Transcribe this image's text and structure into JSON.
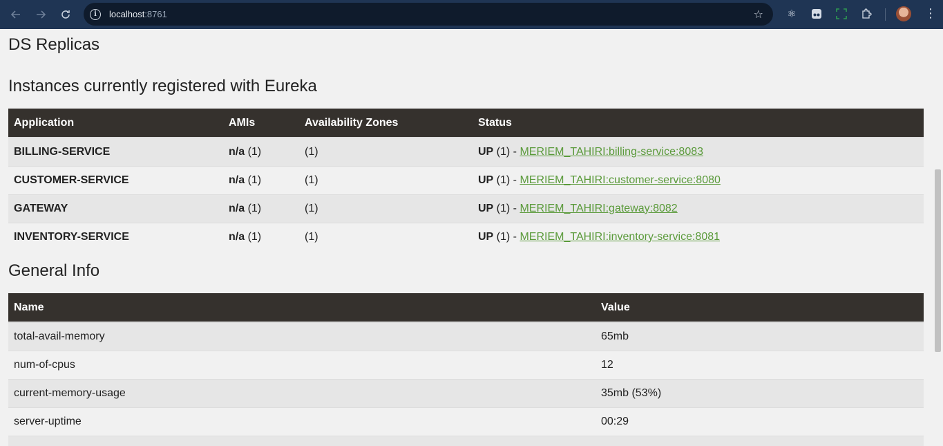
{
  "browser": {
    "url_host": "localhost",
    "url_port": ":8761"
  },
  "page": {
    "ds_replicas_title": "DS Replicas",
    "instances_title": "Instances currently registered with Eureka",
    "general_title": "General Info",
    "instances_headers": [
      "Application",
      "AMIs",
      "Availability Zones",
      "Status"
    ],
    "instances": [
      {
        "app": "BILLING-SERVICE",
        "ami_bold": "n/a",
        "ami_count": " (1)",
        "zones": "(1)",
        "status_bold": "UP",
        "status_text": " (1) - ",
        "link": "MERIEM_TAHIRI:billing-service:8083"
      },
      {
        "app": "CUSTOMER-SERVICE",
        "ami_bold": "n/a",
        "ami_count": " (1)",
        "zones": "(1)",
        "status_bold": "UP",
        "status_text": " (1) - ",
        "link": "MERIEM_TAHIRI:customer-service:8080"
      },
      {
        "app": "GATEWAY",
        "ami_bold": "n/a",
        "ami_count": " (1)",
        "zones": "(1)",
        "status_bold": "UP",
        "status_text": " (1) - ",
        "link": "MERIEM_TAHIRI:gateway:8082"
      },
      {
        "app": "INVENTORY-SERVICE",
        "ami_bold": "n/a",
        "ami_count": " (1)",
        "zones": "(1)",
        "status_bold": "UP",
        "status_text": " (1) - ",
        "link": "MERIEM_TAHIRI:inventory-service:8081"
      }
    ],
    "general_headers": [
      "Name",
      "Value"
    ],
    "general": [
      {
        "name": "total-avail-memory",
        "value": "65mb"
      },
      {
        "name": "num-of-cpus",
        "value": "12"
      },
      {
        "name": "current-memory-usage",
        "value": "35mb (53%)"
      },
      {
        "name": "server-uptime",
        "value": "00:29"
      },
      {
        "name": "",
        "value": ""
      }
    ]
  },
  "colors": {
    "header_bg": "#35312d",
    "link": "#5a9a3a",
    "chrome": "#1f3554"
  }
}
